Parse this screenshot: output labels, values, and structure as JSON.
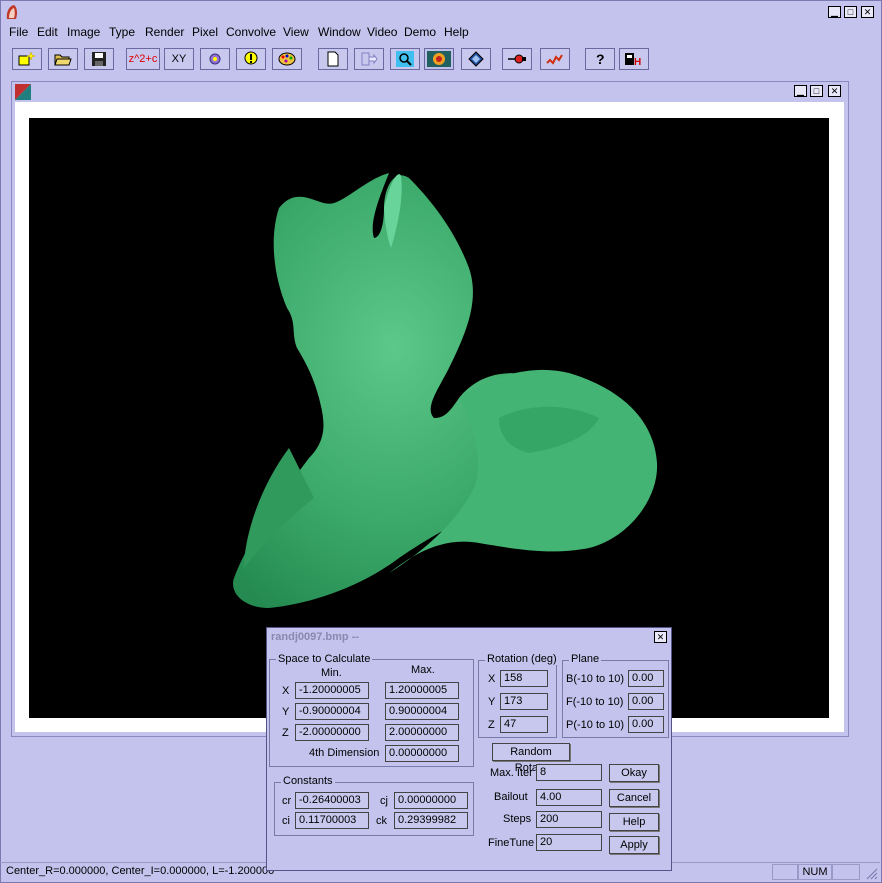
{
  "menu": [
    "File",
    "Edit",
    "Image",
    "Type",
    "Render",
    "Pixel",
    "Convolve",
    "View",
    "Window",
    "Video",
    "Demo",
    "Help"
  ],
  "toolbar": {
    "formula_label": "z^2+c",
    "xy_label": "XY"
  },
  "dialog": {
    "title": "randj0097.bmp --",
    "space": {
      "group_label": "Space to Calculate",
      "min_header": "Min.",
      "max_header": "Max.",
      "x_label": "X",
      "y_label": "Y",
      "z_label": "Z",
      "x_min": "-1.20000005",
      "x_max": "1.20000005",
      "y_min": "-0.90000004",
      "y_max": "0.90000004",
      "z_min": "-2.00000000",
      "z_max": "2.00000000",
      "fourth_label": "4th Dimension",
      "fourth_value": "0.00000000"
    },
    "rotation": {
      "group_label": "Rotation (deg)",
      "x_label": "X",
      "y_label": "Y",
      "z_label": "Z",
      "x": "158",
      "y": "173",
      "z": "47"
    },
    "plane": {
      "group_label": "Plane",
      "b_label": "B(-10 to 10)",
      "f_label": "F(-10 to 10)",
      "p_label": "P(-10 to 10)",
      "b": "0.00",
      "f": "0.00",
      "p": "0.00"
    },
    "constants": {
      "group_label": "Constants",
      "cr_label": "cr",
      "cj_label": "cj",
      "ci_label": "ci",
      "ck_label": "ck",
      "cr": "-0.26400003",
      "cj": "0.00000000",
      "ci": "0.11700003",
      "ck": "0.29399982"
    },
    "random_rotate": "Random Rotate",
    "max_iter_label": "Max. Iter",
    "max_iter": "8",
    "bailout_label": "Bailout",
    "bailout": "4.00",
    "steps_label": "Steps",
    "steps": "200",
    "finetune_label": "FineTune",
    "finetune": "20",
    "okay": "Okay",
    "cancel": "Cancel",
    "help": "Help",
    "apply": "Apply"
  },
  "status": {
    "text": "Center_R=0.000000, Center_I=0.000000, L=-1.200000",
    "num": "NUM"
  },
  "colors": {
    "shape": "#3fae6e",
    "background": "#c3c3ed"
  }
}
